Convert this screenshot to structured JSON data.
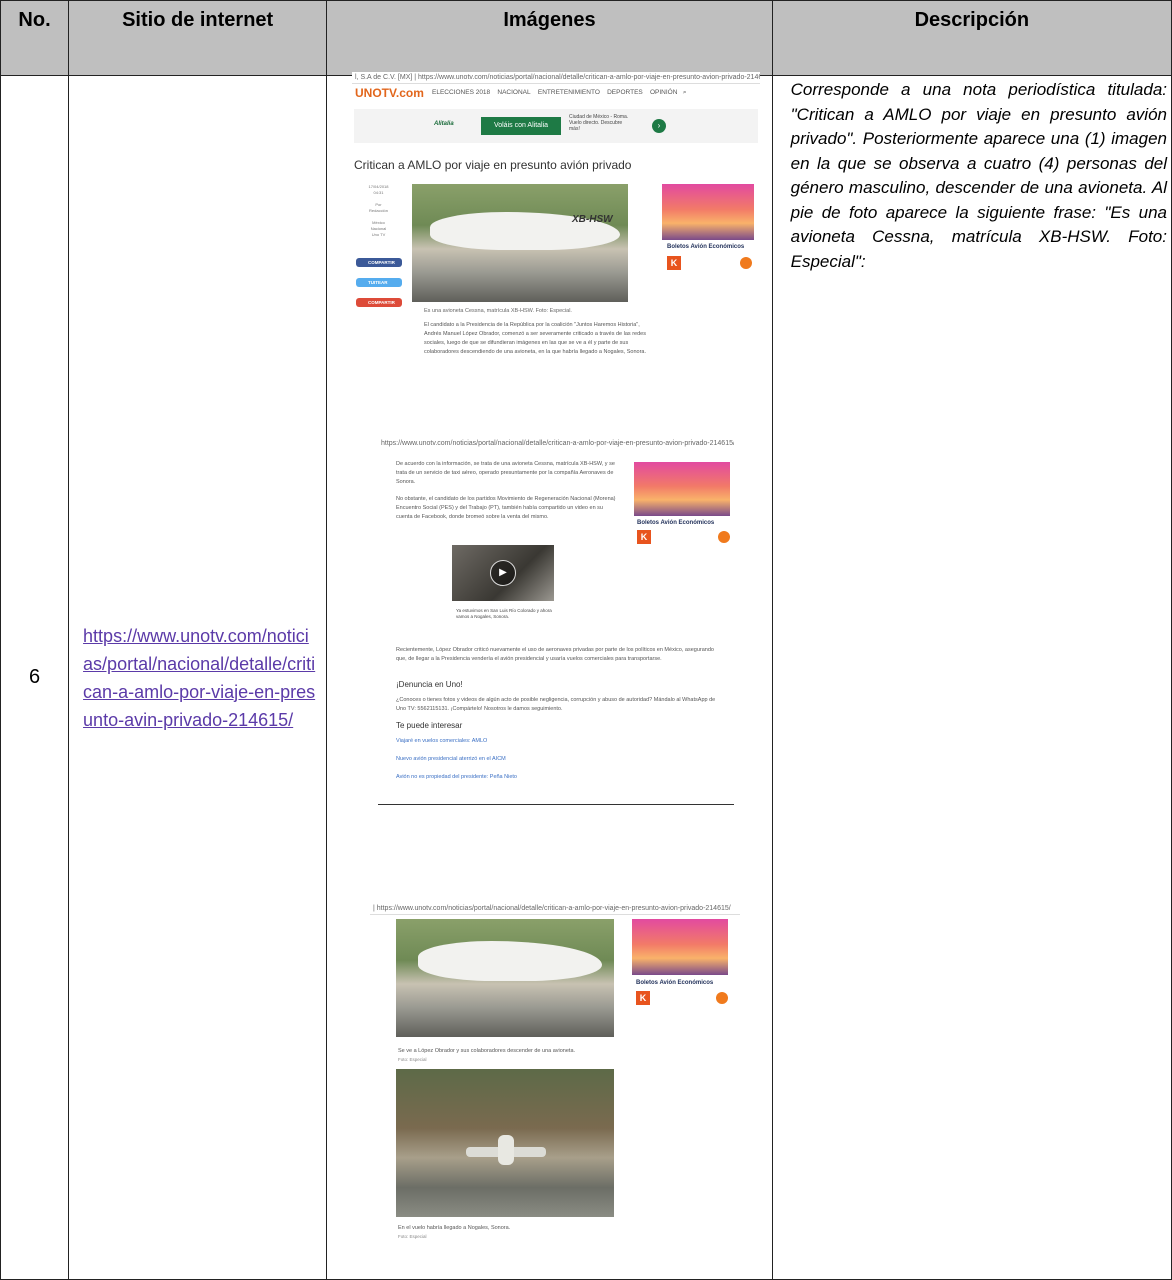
{
  "headers": {
    "no": "No.",
    "site": "Sitio de internet",
    "images": "Imágenes",
    "desc": "Descripción"
  },
  "row": {
    "no": "6",
    "url": "https://www.unotv.com/noticias/portal/nacional/detalle/critican-a-amlo-por-viaje-en-presunto-avin-privado-214615/",
    "description": "Corresponde a una nota periodística titulada: \"Critican a AMLO por viaje en presunto avión privado\". Posteriormente aparece una (1) imagen en la que se observa a cuatro (4) personas del género masculino, descender de una avioneta. Al pie de foto aparece la siguiente frase: \"Es una avioneta Cessna, matrícula XB-HSW. Foto: Especial\":"
  },
  "shot1": {
    "address": "l, S.A de C.V. [MX] | https://www.unotv.com/noticias/portal/nacional/detalle/critican-a-amlo-por-viaje-en-presunto-avion-privado-214615/",
    "logo": "UNOTV.com",
    "nav": [
      "ELECCIONES 2018",
      "NACIONAL",
      "ENTRETENIMIENTO",
      "DEPORTES",
      "OPINIÓN"
    ],
    "banner_brand": "Alitalia",
    "banner_cta": "Voláis con Alitalia",
    "banner_text": "Ciudad de México - Roma. Vuelo directo. Descubre más!",
    "headline": "Critican a AMLO por viaje en presunto avión privado",
    "meta": [
      "17/04/2018",
      "04:31",
      "Por",
      "Redacción",
      "México",
      "Nacional",
      "Uno TV"
    ],
    "buttons": [
      "COMPARTIR",
      "TUITEAR",
      "COMPARTIR"
    ],
    "plane_reg": "XB-HSW",
    "ad_title": "Boletos Avión Económicos",
    "caption": "Es una avioneta Cessna, matrícula XB-HSW. Foto: Especial.",
    "body": "El candidato a la Presidencia de la República por la coalición \"Juntos Haremos Historia\", Andrés Manuel López Obrador, comenzó a ser severamente criticado a través de las redes sociales, luego de que se difundieran imágenes en las que se ve a él y parte de sus colaboradores descendiendo de una avioneta, en la que habría llegado a Nogales, Sonora."
  },
  "shot2": {
    "address": "https://www.unotv.com/noticias/portal/nacional/detalle/critican-a-amlo-por-viaje-en-presunto-avion-privado-214615/",
    "p1": "De acuerdo con la información, se trata de una avioneta Cessna, matrícula XB-HSW, y se trata de un servicio de taxi aéreo, operado presuntamente por la compañía Aeronaves de Sonora.",
    "p2": "No obstante, el candidato de los partidos Movimiento de Regeneración Nacional (Morena) Encuentro Social (PES) y del Trabajo (PT), también había compartido un video en su cuenta de Facebook, donde bromeó sobre la venta del mismo.",
    "video_caption": "Ya estuvimos en San Luis Río Colorado y ahora vamos a Nogales, Sonora.",
    "p3": "Recientemente, López Obrador criticó nuevamente el uso de aeronaves privadas por parte de los políticos en México, asegurando que, de llegar a la Presidencia vendería el avión presidencial y usaría vuelos comerciales para transportarse.",
    "denuncia": "¡Denuncia en Uno!",
    "p4": "¿Conoces o tienes fotos y videos de algún acto de posible negligencia, corrupción y abuso de autoridad? Mándalo al WhatsApp de Uno TV: 5562115131. ¡Compártelo! Nosotros le damos seguimiento.",
    "interesar": "Te puede interesar",
    "links": [
      "Viajaré en vuelos comerciales: AMLO",
      "Nuevo avión presidencial aterrizó en el AICM",
      "Avión no es propiedad del presidente: Peña Nieto"
    ],
    "ad_title": "Boletos Avión Económicos"
  },
  "shot3": {
    "address": "| https://www.unotv.com/noticias/portal/nacional/detalle/critican-a-amlo-por-viaje-en-presunto-avion-privado-214615/",
    "caption1": "Se ve a López Obrador y sus colaboradores descender de una avioneta.",
    "credit1": "Foto: Especial",
    "caption2": "En el vuelo habría llegado a Nogales, Sonora.",
    "credit2": "Foto: Especial",
    "ad_title": "Boletos Avión Económicos"
  }
}
